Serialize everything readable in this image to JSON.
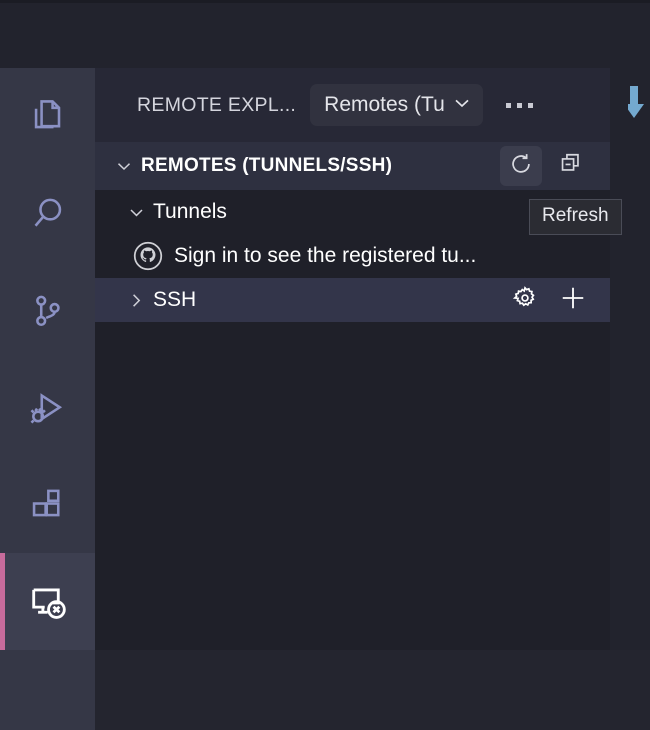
{
  "window": {
    "title_bar": "",
    "theme_colors": {
      "activity_bar_bg": "#353746",
      "sidebar_bg": "#272836",
      "section_header_bg": "#2e3040",
      "tree_bg": "#1f2029",
      "editor_bg": "#22232d",
      "active_indicator": "#c76b9b",
      "hover_row": "#33354a",
      "text_primary": "#ffffff",
      "cursor_arrow": "#74a9cf"
    }
  },
  "activity_bar": {
    "items": [
      {
        "name": "explorer",
        "icon": "files-icon",
        "active": false
      },
      {
        "name": "search",
        "icon": "search-icon",
        "active": false
      },
      {
        "name": "source-control",
        "icon": "source-control-icon",
        "active": false
      },
      {
        "name": "run-and-debug",
        "icon": "run-debug-icon",
        "active": false
      },
      {
        "name": "extensions",
        "icon": "extensions-icon",
        "active": false
      },
      {
        "name": "remote-explorer",
        "icon": "remote-explorer-icon",
        "active": true
      }
    ]
  },
  "sidebar": {
    "title": "REMOTE EXPL...",
    "view_picker": {
      "label": "Remotes (Tu",
      "chevron": "chevron-down-icon"
    },
    "more_actions_label": "...",
    "section": {
      "title": "REMOTES (TUNNELS/SSH)",
      "expanded": true,
      "actions": [
        {
          "name": "refresh",
          "icon": "refresh-icon",
          "hovered": true
        },
        {
          "name": "collapse-all",
          "icon": "collapse-all-icon",
          "hovered": false
        }
      ]
    },
    "tree": [
      {
        "label": "Tunnels",
        "level": 1,
        "twisty": "chevron-down-icon",
        "expanded": true,
        "icon": null,
        "hover": false,
        "actions": []
      },
      {
        "label": "Sign in to see the registered tu...",
        "level": 2,
        "twisty": null,
        "expanded": false,
        "icon": "github-icon",
        "hover": false,
        "actions": []
      },
      {
        "label": "SSH",
        "level": 1,
        "twisty": "chevron-right-icon",
        "expanded": false,
        "icon": null,
        "hover": true,
        "actions": [
          {
            "name": "configure-ssh-hosts",
            "icon": "gear-icon"
          },
          {
            "name": "add-new-ssh-host",
            "icon": "plus-icon"
          }
        ]
      }
    ]
  },
  "tooltip": {
    "text": "Refresh",
    "visible": true
  },
  "cursor": {
    "icon": "arrow-cursor-icon",
    "color": "#74a9cf"
  }
}
